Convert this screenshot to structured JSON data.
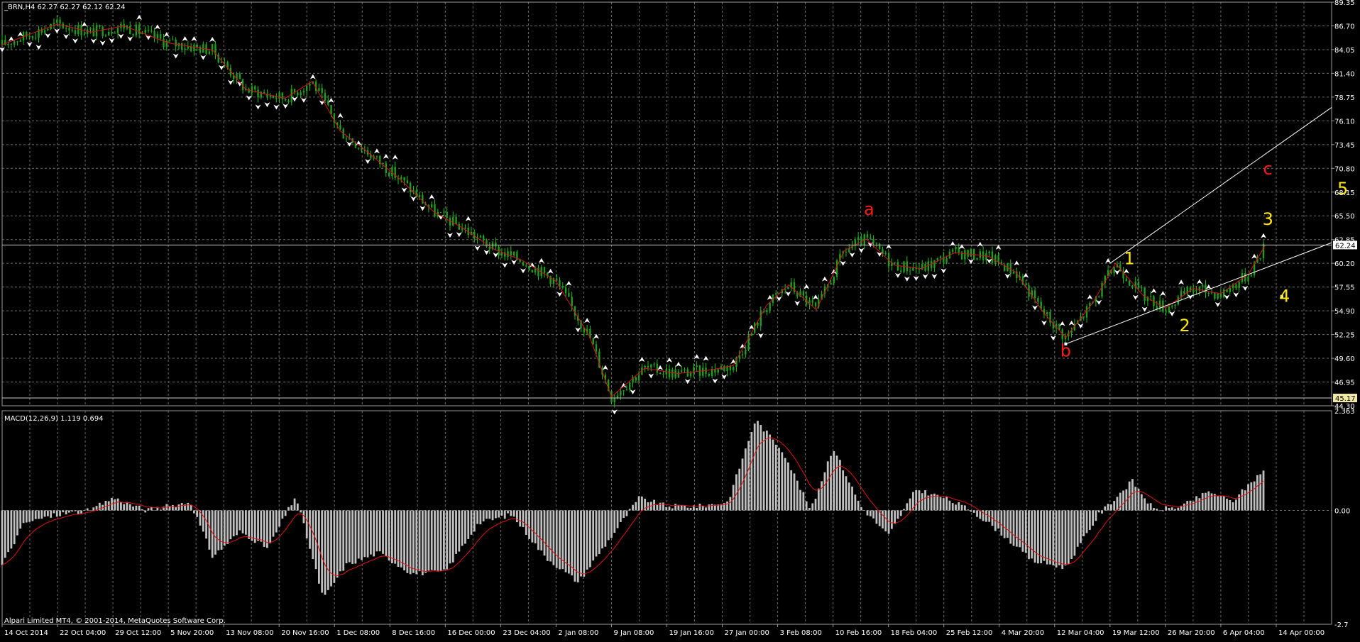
{
  "colors": {
    "background": "#000000",
    "grid": "#6b6b6b",
    "candle_body": "#1e9e1e",
    "candle_wick": "#19c419",
    "zigzag": "#e01010",
    "trendline": "#ffffff",
    "fractal": "#ffffff",
    "wave_count_red": "#ff1a1a",
    "wave_count_yellow": "#ffe800",
    "macd_histogram": "#c0c0c0",
    "macd_signal": "#e01010",
    "price_tag_bg": "#ffffff",
    "low_tag_bg": "#f2e9a6"
  },
  "header": {
    "symbol_line": "_BRN,H4  62.27 62.27 62.12 62.24"
  },
  "macd_header": "MACD(12,26,9) 1.119 0.694",
  "copyright": "Alpari Limited MT4, © 2001-2014, MetaQuotes Software Corp.",
  "chart_data": [
    {
      "type": "candlestick",
      "panel": "price",
      "symbol": "_BRN",
      "timeframe": "H4",
      "last_bar": {
        "open": 62.27,
        "high": 62.27,
        "low": 62.12,
        "close": 62.24
      },
      "current_price_tag": "62.24",
      "low_marker_tag": "45.17",
      "ylim": [
        44.3,
        89.35
      ],
      "y_ticks": [
        "89.35",
        "86.70",
        "84.05",
        "81.40",
        "78.75",
        "76.10",
        "73.45",
        "70.80",
        "68.15",
        "65.50",
        "62.85",
        "60.20",
        "57.55",
        "54.90",
        "52.25",
        "49.60",
        "46.95",
        "44.30"
      ],
      "x_ticks": [
        "14 Oct 2014",
        "22 Oct 04:00",
        "29 Oct 12:00",
        "5 Nov 20:00",
        "13 Nov 08:00",
        "20 Nov 16:00",
        "1 Dec 08:00",
        "8 Dec 16:00",
        "16 Dec 00:00",
        "23 Dec 04:00",
        "2 Jan 08:00",
        "9 Jan 08:00",
        "19 Jan 16:00",
        "27 Jan 00:00",
        "3 Feb 08:00",
        "10 Feb 16:00",
        "18 Feb 04:00",
        "25 Feb 12:00",
        "4 Mar 20:00",
        "12 Mar 04:00",
        "19 Mar 12:00",
        "26 Mar 20:00",
        "6 Apr 04:00",
        "14 Apr 00:00"
      ],
      "price_path": [
        {
          "x": 0.0,
          "y": 84.6
        },
        {
          "x": 0.6,
          "y": 86.0
        },
        {
          "x": 1.0,
          "y": 86.9
        },
        {
          "x": 1.6,
          "y": 86.0
        },
        {
          "x": 2.2,
          "y": 86.7
        },
        {
          "x": 3.0,
          "y": 84.8
        },
        {
          "x": 3.8,
          "y": 84.0
        },
        {
          "x": 4.4,
          "y": 79.6
        },
        {
          "x": 5.1,
          "y": 78.6
        },
        {
          "x": 5.6,
          "y": 80.5
        },
        {
          "x": 6.1,
          "y": 75.0
        },
        {
          "x": 6.6,
          "y": 72.6
        },
        {
          "x": 7.2,
          "y": 69.5
        },
        {
          "x": 7.8,
          "y": 65.9
        },
        {
          "x": 8.3,
          "y": 64.2
        },
        {
          "x": 8.9,
          "y": 61.7
        },
        {
          "x": 9.4,
          "y": 60.5
        },
        {
          "x": 10.0,
          "y": 58.2
        },
        {
          "x": 10.6,
          "y": 52.1
        },
        {
          "x": 11.0,
          "y": 45.3
        },
        {
          "x": 11.6,
          "y": 48.5
        },
        {
          "x": 12.2,
          "y": 47.9
        },
        {
          "x": 12.8,
          "y": 48.3
        },
        {
          "x": 13.2,
          "y": 48.8
        },
        {
          "x": 13.8,
          "y": 55.5
        },
        {
          "x": 14.2,
          "y": 57.8
        },
        {
          "x": 14.7,
          "y": 55.0
        },
        {
          "x": 15.2,
          "y": 61.6
        },
        {
          "x": 15.6,
          "y": 62.9
        },
        {
          "x": 16.1,
          "y": 60.0
        },
        {
          "x": 16.6,
          "y": 59.6
        },
        {
          "x": 17.2,
          "y": 61.4
        },
        {
          "x": 17.8,
          "y": 61.0
        },
        {
          "x": 18.3,
          "y": 59.2
        },
        {
          "x": 18.8,
          "y": 54.7
        },
        {
          "x": 19.2,
          "y": 51.9
        },
        {
          "x": 19.7,
          "y": 55.9
        },
        {
          "x": 20.1,
          "y": 60.2
        },
        {
          "x": 20.6,
          "y": 56.6
        },
        {
          "x": 21.0,
          "y": 55.2
        },
        {
          "x": 21.5,
          "y": 57.4
        },
        {
          "x": 22.0,
          "y": 56.8
        },
        {
          "x": 22.5,
          "y": 59.0
        },
        {
          "x": 22.8,
          "y": 62.2
        }
      ],
      "channel_lines": [
        {
          "from": {
            "x": 20.0,
            "y": 60.2
          },
          "to": {
            "x": 27.5,
            "y": 77.6
          }
        },
        {
          "from": {
            "x": 19.2,
            "y": 51.2
          },
          "to": {
            "x": 27.5,
            "y": 62.5
          }
        }
      ],
      "horizontal_lines": [
        62.24,
        45.17
      ],
      "wave_labels": [
        {
          "text": "a",
          "color": "red",
          "x": 15.65,
          "y": 65.6
        },
        {
          "text": "b",
          "color": "red",
          "x": 19.2,
          "y": 49.8
        },
        {
          "text": "c",
          "color": "red",
          "x": 22.85,
          "y": 70.1
        },
        {
          "text": "1",
          "color": "yellow",
          "x": 20.35,
          "y": 60.1
        },
        {
          "text": "2",
          "color": "yellow",
          "x": 21.35,
          "y": 52.6
        },
        {
          "text": "3",
          "color": "yellow",
          "x": 22.85,
          "y": 64.5
        },
        {
          "text": "4",
          "color": "yellow",
          "x": 23.15,
          "y": 55.9
        },
        {
          "text": "5",
          "color": "yellow",
          "x": 24.2,
          "y": 67.9
        }
      ]
    },
    {
      "type": "macd",
      "panel": "indicator",
      "params": "12,26,9",
      "macd": 1.119,
      "signal": 0.694,
      "ylim": [
        -2.7,
        2.363
      ],
      "y_ticks": [
        "2.363",
        "0.00",
        "-2.7"
      ],
      "histogram_path": [
        {
          "x": 0.0,
          "y": -1.3
        },
        {
          "x": 0.4,
          "y": -0.3
        },
        {
          "x": 1.0,
          "y": -0.1
        },
        {
          "x": 1.6,
          "y": 0.0
        },
        {
          "x": 2.0,
          "y": 0.3
        },
        {
          "x": 2.6,
          "y": 0.0
        },
        {
          "x": 3.4,
          "y": 0.2
        },
        {
          "x": 3.8,
          "y": -1.1
        },
        {
          "x": 4.3,
          "y": -0.5
        },
        {
          "x": 4.8,
          "y": -0.9
        },
        {
          "x": 5.3,
          "y": 0.35
        },
        {
          "x": 5.8,
          "y": -2.1
        },
        {
          "x": 6.2,
          "y": -1.3
        },
        {
          "x": 6.8,
          "y": -1.0
        },
        {
          "x": 7.4,
          "y": -1.5
        },
        {
          "x": 8.0,
          "y": -1.45
        },
        {
          "x": 8.6,
          "y": -0.3
        },
        {
          "x": 9.2,
          "y": -0.1
        },
        {
          "x": 9.8,
          "y": -1.1
        },
        {
          "x": 10.4,
          "y": -1.7
        },
        {
          "x": 10.9,
          "y": -0.8
        },
        {
          "x": 11.5,
          "y": 0.3
        },
        {
          "x": 12.0,
          "y": 0.1
        },
        {
          "x": 12.6,
          "y": 0.1
        },
        {
          "x": 13.1,
          "y": 0.2
        },
        {
          "x": 13.6,
          "y": 2.15
        },
        {
          "x": 14.1,
          "y": 1.4
        },
        {
          "x": 14.6,
          "y": 0.0
        },
        {
          "x": 15.0,
          "y": 1.5
        },
        {
          "x": 15.5,
          "y": 0.1
        },
        {
          "x": 16.0,
          "y": -0.6
        },
        {
          "x": 16.5,
          "y": 0.5
        },
        {
          "x": 17.0,
          "y": 0.3
        },
        {
          "x": 17.5,
          "y": 0.0
        },
        {
          "x": 18.0,
          "y": -0.5
        },
        {
          "x": 18.6,
          "y": -1.2
        },
        {
          "x": 19.2,
          "y": -1.35
        },
        {
          "x": 19.8,
          "y": -0.1
        },
        {
          "x": 20.4,
          "y": 0.7
        },
        {
          "x": 20.8,
          "y": 0.0
        },
        {
          "x": 21.3,
          "y": 0.1
        },
        {
          "x": 21.8,
          "y": 0.45
        },
        {
          "x": 22.2,
          "y": 0.2
        },
        {
          "x": 22.8,
          "y": 1.0
        }
      ]
    }
  ]
}
